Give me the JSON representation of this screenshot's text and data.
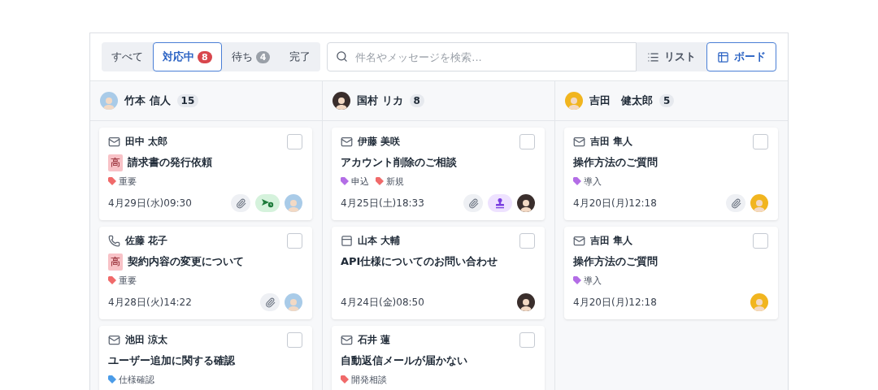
{
  "tabs": [
    {
      "label": "すべて",
      "selected": false
    },
    {
      "label": "対応中",
      "count": "8",
      "kind": "alert",
      "selected": true
    },
    {
      "label": "待ち",
      "count": "4",
      "kind": "muted",
      "selected": false
    },
    {
      "label": "完了",
      "selected": false
    }
  ],
  "search": {
    "placeholder": "件名やメッセージを検索..."
  },
  "views": [
    {
      "kind": "list",
      "label": "リスト",
      "selected": false
    },
    {
      "kind": "board",
      "label": "ボード",
      "selected": true
    }
  ],
  "columns": [
    {
      "assignee": "竹本 信人",
      "count": "15",
      "cards": [
        {
          "kind": "mail",
          "sender": "田中 太郎",
          "priority": "高",
          "subject": "請求書の発行依頼",
          "tags": [
            {
              "label": "重要",
              "color": "#f06a6a"
            }
          ],
          "date": "4月29日(水)09:30",
          "attachment": true,
          "status": {
            "kind": "sent"
          },
          "checked": false
        },
        {
          "kind": "phone",
          "sender": "佐藤 花子",
          "priority": "高",
          "subject": "契約内容の変更について",
          "tags": [
            {
              "label": "重要",
              "color": "#f06a6a"
            }
          ],
          "date": "4月28日(火)14:22",
          "attachment": true,
          "checked": false
        },
        {
          "kind": "mail",
          "sender": "池田 涼太",
          "subject": "ユーザー追加に関する確認",
          "tags": [
            {
              "label": "仕様確認",
              "color": "#4b9ce8"
            }
          ],
          "checked": false
        }
      ]
    },
    {
      "assignee": "国村 リカ",
      "count": "8",
      "cards": [
        {
          "kind": "mail",
          "sender": "伊藤 美咲",
          "subject": "アカウント削除のご相談",
          "tags": [
            {
              "label": "申込",
              "color": "#b36de6"
            },
            {
              "label": "新規",
              "color": "#f06a6a"
            }
          ],
          "date": "4月25日(土)18:33",
          "attachment": true,
          "status": {
            "kind": "stamp"
          },
          "checked": false
        },
        {
          "kind": "form",
          "sender": "山本 大輔",
          "subject": "API仕様についてのお問い合わせ",
          "date": "4月24日(金)08:50",
          "attachment": false,
          "checked": false
        },
        {
          "kind": "mail",
          "sender": "石井 蓮",
          "subject": "自動返信メールが届かない",
          "tags": [
            {
              "label": "開発相談",
              "color": "#f06a6a"
            }
          ],
          "checked": false
        }
      ]
    },
    {
      "assignee": "吉田　健太郎",
      "count": "5",
      "cards": [
        {
          "kind": "mail",
          "sender": "吉田 隼人",
          "subject": "操作方法のご質問",
          "tags": [
            {
              "label": "導入",
              "color": "#b36de6"
            }
          ],
          "date": "4月20日(月)12:18",
          "attachment": true,
          "checked": false
        },
        {
          "kind": "mail",
          "sender": "吉田 隼人",
          "subject": "操作方法のご質問",
          "tags": [
            {
              "label": "導入",
              "color": "#b36de6"
            }
          ],
          "date": "4月20日(月)12:18",
          "attachment": false,
          "checked": false
        }
      ]
    }
  ]
}
